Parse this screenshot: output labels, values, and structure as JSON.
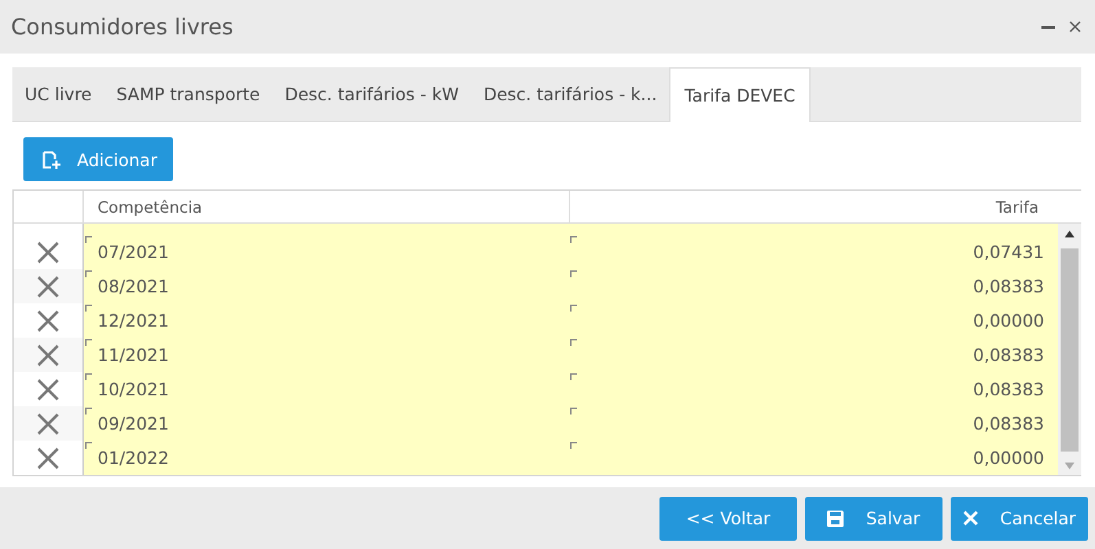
{
  "window": {
    "title": "Consumidores livres"
  },
  "tabs": [
    {
      "label": "UC livre",
      "selected": false
    },
    {
      "label": "SAMP transporte",
      "selected": false
    },
    {
      "label": "Desc. tarifários - kW",
      "selected": false
    },
    {
      "label": "Desc. tarifários - k...",
      "selected": false
    },
    {
      "label": "Tarifa DEVEC",
      "selected": true
    }
  ],
  "add_button": "Adicionar",
  "table": {
    "columns": [
      "Competência",
      "Tarifa"
    ],
    "rows": [
      {
        "competencia": "07/2021",
        "tarifa": "0,07431"
      },
      {
        "competencia": "08/2021",
        "tarifa": "0,08383"
      },
      {
        "competencia": "12/2021",
        "tarifa": "0,00000"
      },
      {
        "competencia": "11/2021",
        "tarifa": "0,08383"
      },
      {
        "competencia": "10/2021",
        "tarifa": "0,08383"
      },
      {
        "competencia": "09/2021",
        "tarifa": "0,08383"
      },
      {
        "competencia": "01/2022",
        "tarifa": "0,00000"
      }
    ]
  },
  "footer_buttons": [
    {
      "kind": "back",
      "label": "<< Voltar"
    },
    {
      "kind": "save",
      "label": "Salvar"
    },
    {
      "kind": "cancel",
      "label": "Cancelar"
    }
  ]
}
